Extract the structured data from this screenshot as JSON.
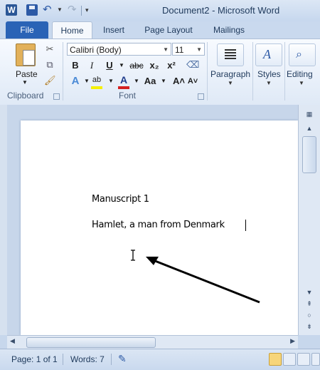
{
  "window": {
    "title": "Document2  -  Microsoft Word"
  },
  "qat": {
    "app_icon_letter": "W"
  },
  "tabs": [
    "File",
    "Home",
    "Insert",
    "Page Layout",
    "Mailings"
  ],
  "ribbon": {
    "clipboard": {
      "paste_label": "Paste",
      "group_label": "Clipboard"
    },
    "font": {
      "font_name": "Calibri (Body)",
      "font_size": "11",
      "bold": "B",
      "italic": "I",
      "underline": "U",
      "strike": "abc",
      "subscript": "x₂",
      "superscript": "x²",
      "change_case": "Aa",
      "grow_font": "A˄",
      "shrink_font": "A˅",
      "group_label": "Font"
    },
    "paragraph": {
      "label": "Paragraph"
    },
    "styles": {
      "label": "Styles"
    },
    "editing": {
      "label": "Editing"
    }
  },
  "document": {
    "lines": [
      "Manuscript 1",
      "Hamlet, a man from Denmark"
    ]
  },
  "status": {
    "page": "Page: 1 of 1",
    "words": "Words: 7"
  },
  "colors": {
    "file_tab": "#2a63b6",
    "font_color_bar": "#d42020",
    "highlight_bar": "#f5f000"
  }
}
